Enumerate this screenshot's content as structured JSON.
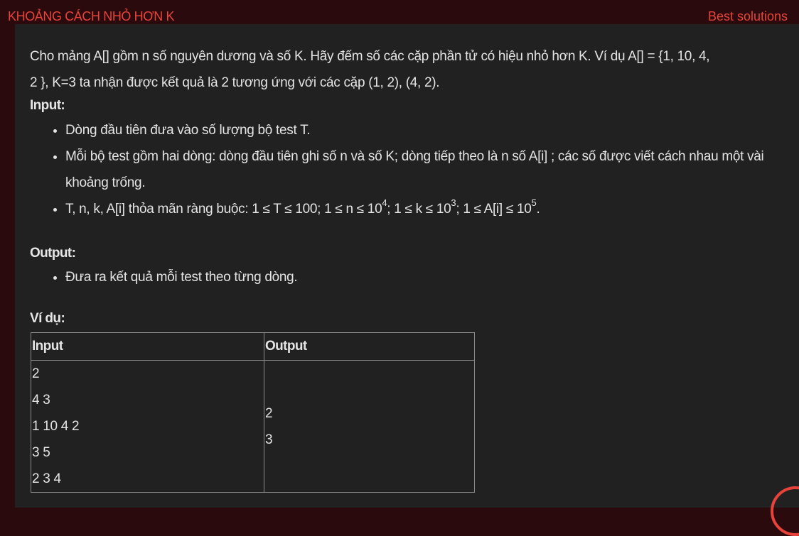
{
  "header": {
    "title": "KHOẢNG CÁCH NHỎ HƠN K",
    "best_solutions": "Best solutions"
  },
  "problem": {
    "description_line1": "Cho mảng A[] gồm n số nguyên dương và số K. Hãy đếm số các cặp phần tử có hiệu nhỏ hơn K. Ví dụ A[] = {1, 10, 4,",
    "description_line2": "2 }, K=3 ta nhận được kết quả là 2 tương ứng với các cặp (1, 2), (4, 2).",
    "input_heading": "Input:",
    "input_items": {
      "item1": "Dòng đầu tiên đưa vào số lượng bộ test T.",
      "item2": "Mỗi bộ test gồm hai dòng: dòng đầu tiên ghi số n và số K; dòng tiếp theo là n số A[i] ; các số được viết cách nhau một vài khoảng trống.",
      "item3": {
        "p1": "T, n, k, A[i] thỏa mãn ràng buộc: 1 ≤  T  ≤ 100; 1 ≤  n  ≤ 10",
        "e1": "4",
        "p2": "; 1 ≤  k ≤ 10",
        "e2": "3",
        "p3": "; 1 ≤  A[i]  ≤ 10",
        "e3": "5",
        "p4": "."
      }
    },
    "output_heading": "Output:",
    "output_items": {
      "item1": "Đưa ra kết quả mỗi test theo từng dòng."
    },
    "example_heading": "Ví dụ:",
    "example_table": {
      "header_input": "Input",
      "header_output": "Output",
      "input_lines": [
        "2",
        "4 3",
        "1 10 4 2",
        "3 5",
        "2 3 4"
      ],
      "output_lines": [
        "2",
        "3"
      ]
    }
  },
  "colors": {
    "accent": "#e8433b",
    "background": "#2a0a0c",
    "panel": "#212121",
    "text": "#e4e4e4"
  }
}
